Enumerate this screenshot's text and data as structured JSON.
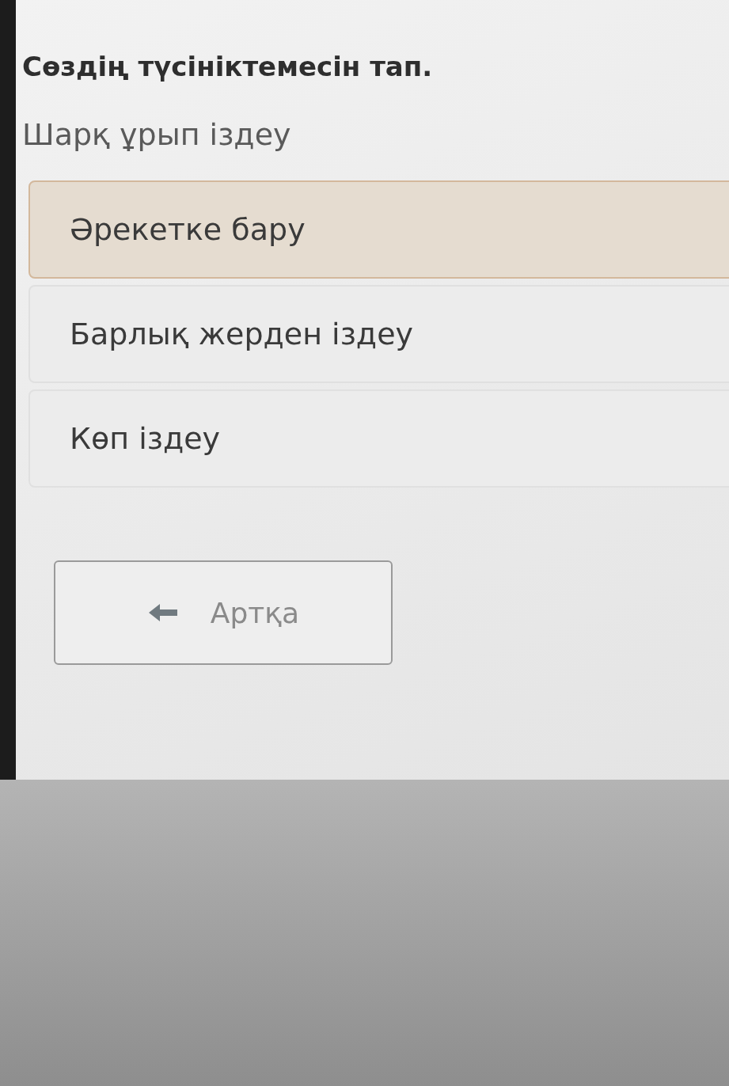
{
  "question": {
    "title": "Сөздің түсініктемесін тап.",
    "word": "Шарқ ұрып іздеу"
  },
  "options": [
    {
      "label": "Әрекетке бару",
      "selected": true
    },
    {
      "label": "Барлық жерден іздеу",
      "selected": false
    },
    {
      "label": "Көп іздеу",
      "selected": false
    }
  ],
  "back_button": {
    "label": "Артқа"
  }
}
